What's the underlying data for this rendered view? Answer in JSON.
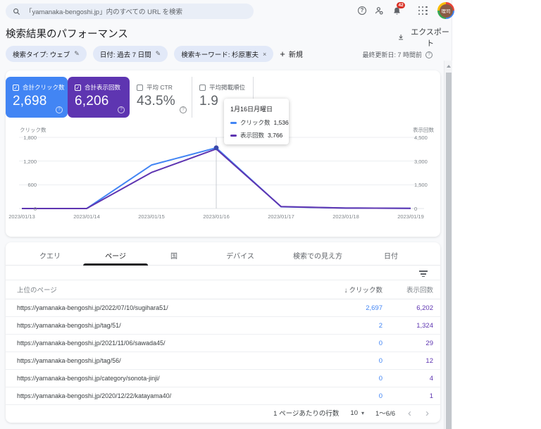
{
  "topbar": {
    "search_placeholder": "「yamanaka-bengoshi.jp」内のすべての URL を検索",
    "notification_count": "42",
    "avatar_text": "理司"
  },
  "page": {
    "title": "検索結果のパフォーマンス",
    "export_label": "エクスポート",
    "last_updated": "最終更新日: 7 時間前"
  },
  "filters": {
    "chips": [
      {
        "label": "検索タイプ: ウェブ",
        "action": "edit"
      },
      {
        "label": "日付: 過去 7 日間",
        "action": "edit"
      },
      {
        "label": "検索キーワード: 杉原憲夫",
        "action": "remove"
      }
    ],
    "new_label": "新規"
  },
  "metrics": [
    {
      "label": "合計クリック数",
      "value": "2,698",
      "selected": true,
      "bg": "#4285f4"
    },
    {
      "label": "合計表示回数",
      "value": "6,206",
      "selected": true,
      "bg": "#5e35b1"
    },
    {
      "label": "平均 CTR",
      "value": "43.5%",
      "selected": false,
      "bg": ""
    },
    {
      "label": "平均掲載順位",
      "value": "1.9",
      "selected": false,
      "bg": ""
    }
  ],
  "tooltip": {
    "title": "1月16日月曜日",
    "rows": [
      {
        "label": "クリック数",
        "value": "1,536",
        "color": "#4285f4"
      },
      {
        "label": "表示回数",
        "value": "3,766",
        "color": "#5e35b1"
      }
    ]
  },
  "chart_data": {
    "type": "line",
    "x": [
      "2023/01/13",
      "2023/01/14",
      "2023/01/15",
      "2023/01/16",
      "2023/01/17",
      "2023/01/18",
      "2023/01/19"
    ],
    "series": [
      {
        "name": "クリック数",
        "color": "#4285f4",
        "axis": "left",
        "values": [
          0,
          0,
          1100,
          1536,
          45,
          12,
          5
        ]
      },
      {
        "name": "表示回数",
        "color": "#5e35b1",
        "axis": "right",
        "values": [
          0,
          0,
          2280,
          3766,
          120,
          30,
          10
        ]
      }
    ],
    "left_axis": {
      "label": "クリック数",
      "max": 1800,
      "ticks": [
        "1,800",
        "1,200",
        "600",
        "0"
      ]
    },
    "right_axis": {
      "label": "表示回数",
      "max": 4500,
      "ticks": [
        "4,500",
        "3,000",
        "1,500",
        "0"
      ]
    },
    "highlight_index": 3,
    "grid": true,
    "legend_position": "none"
  },
  "tabs": {
    "items": [
      "クエリ",
      "ページ",
      "国",
      "デバイス",
      "検索での見え方",
      "日付"
    ],
    "active": "ページ"
  },
  "table": {
    "columns": [
      "上位のページ",
      "クリック数",
      "表示回数"
    ],
    "sort_column": "クリック数",
    "rows": [
      {
        "page": "https://yamanaka-bengoshi.jp/2022/07/10/sugihara51/",
        "clicks": "2,697",
        "impressions": "6,202"
      },
      {
        "page": "https://yamanaka-bengoshi.jp/tag/51/",
        "clicks": "2",
        "impressions": "1,324"
      },
      {
        "page": "https://yamanaka-bengoshi.jp/2021/11/06/sawada45/",
        "clicks": "0",
        "impressions": "29"
      },
      {
        "page": "https://yamanaka-bengoshi.jp/tag/56/",
        "clicks": "0",
        "impressions": "12"
      },
      {
        "page": "https://yamanaka-bengoshi.jp/category/sonota-jinji/",
        "clicks": "0",
        "impressions": "4"
      },
      {
        "page": "https://yamanaka-bengoshi.jp/2020/12/22/katayama40/",
        "clicks": "0",
        "impressions": "1"
      }
    ],
    "pagination": {
      "rows_per_page_label": "1 ページあたりの行数",
      "rows_per_page": "10",
      "range": "1～6/6"
    }
  }
}
